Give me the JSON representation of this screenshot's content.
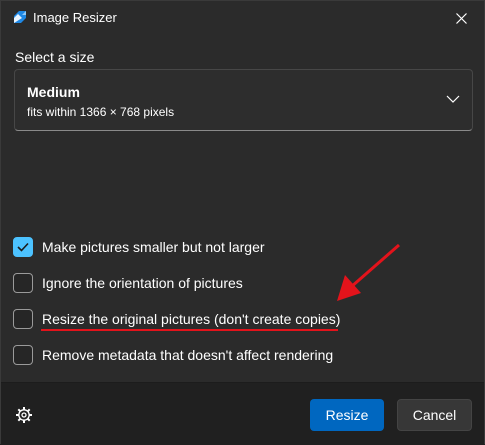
{
  "window": {
    "title": "Image Resizer"
  },
  "size_section": {
    "label": "Select a size",
    "selected_name": "Medium",
    "selected_description": "fits within 1366 × 768 pixels"
  },
  "options": [
    {
      "label": "Make pictures smaller but not larger",
      "checked": true
    },
    {
      "label": "Ignore the orientation of pictures",
      "checked": false
    },
    {
      "label": "Resize the original pictures (don't create copies)",
      "checked": false
    },
    {
      "label": "Remove metadata that doesn't affect rendering",
      "checked": false
    }
  ],
  "footer": {
    "resize_label": "Resize",
    "cancel_label": "Cancel"
  },
  "colors": {
    "accent": "#4cc2ff",
    "primary_button": "#0067c0",
    "annotation": "#e3131b"
  },
  "icons": {
    "app": "image-resizer-icon",
    "close": "close-icon",
    "chevron": "chevron-down-icon",
    "settings": "gear-icon"
  }
}
